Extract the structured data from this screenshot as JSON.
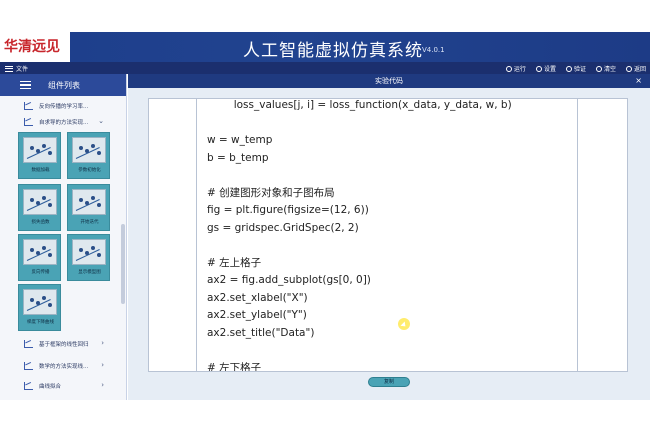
{
  "app": {
    "logo_text": "华清远见",
    "title": "人工智能虚拟仿真系统",
    "version": "V4.0.1"
  },
  "menubar": {
    "file_label": "文件",
    "tools": [
      {
        "icon": "run-icon",
        "label": "运行"
      },
      {
        "icon": "gear-icon",
        "label": "设置"
      },
      {
        "icon": "verify-icon",
        "label": "验证"
      },
      {
        "icon": "clear-icon",
        "label": "清空"
      },
      {
        "icon": "back-icon",
        "label": "返回"
      }
    ]
  },
  "sidebar": {
    "title": "组件列表",
    "top_items": [
      {
        "label": "反向传播的学习率..."
      },
      {
        "label": "自求导的方法实现..."
      }
    ],
    "tiles": [
      {
        "label": "数据加载"
      },
      {
        "label": "参数初始化"
      },
      {
        "label": "损失函数"
      },
      {
        "label": "开始迭代"
      },
      {
        "label": "反向传播"
      },
      {
        "label": "显示模型图"
      },
      {
        "label": "梯度下降曲线"
      }
    ],
    "bottom_items": [
      {
        "label": "基于框架的线性回归"
      },
      {
        "label": "数学的方法实现线..."
      },
      {
        "label": "曲线拟合"
      }
    ]
  },
  "panel": {
    "title": "实验代码",
    "close": "×",
    "copy_button": "复制"
  },
  "code_lines": [
    "        loss_values[j, i] = loss_function(x_data, y_data, w, b)",
    "",
    "w = w_temp",
    "b = b_temp",
    "",
    "# 创建图形对象和子图布局",
    "fig = plt.figure(figsize=(12, 6))",
    "gs = gridspec.GridSpec(2, 2)",
    "",
    "# 左上格子",
    "ax2 = fig.add_subplot(gs[0, 0])",
    "ax2.set_xlabel(\"X\")",
    "ax2.set_ylabel(\"Y\")",
    "ax2.set_title(\"Data\")",
    "",
    "# 左下格子"
  ]
}
